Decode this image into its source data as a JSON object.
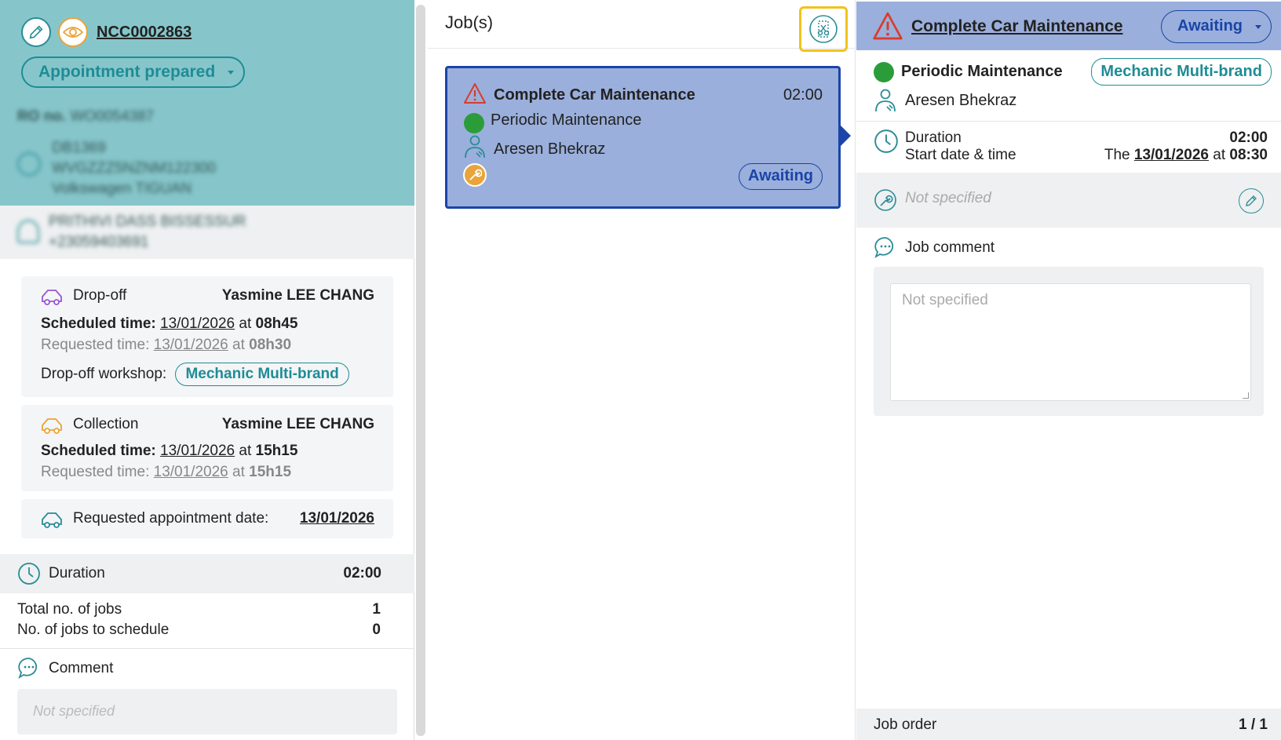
{
  "left": {
    "order_no": "NCC0002863",
    "status": "Appointment prepared",
    "ro_label": "RO no.",
    "ro_value": "WO0054387",
    "vehicle_code": "DB1369",
    "vin": "WVGZZZ5NZNM122300",
    "vehicle_model": "Volkswagen TIGUAN",
    "customer_name": "PRITHIVI DASS BISSESSUR",
    "customer_phone": "+23059403691",
    "dropoff": {
      "title": "Drop-off",
      "person": "Yasmine LEE CHANG",
      "scheduled_label": "Scheduled time:",
      "scheduled_date": "13/01/2026",
      "at": "at",
      "scheduled_time": "08h45",
      "requested_label": "Requested time:",
      "requested_date": "13/01/2026",
      "requested_time": "08h30",
      "workshop_label": "Drop-off workshop:",
      "workshop": "Mechanic Multi-brand"
    },
    "collection": {
      "title": "Collection",
      "person": "Yasmine LEE CHANG",
      "scheduled_label": "Scheduled time:",
      "scheduled_date": "13/01/2026",
      "at": "at",
      "scheduled_time": "15h15",
      "requested_label": "Requested time:",
      "requested_date": "13/01/2026",
      "requested_time": "15h15"
    },
    "requested_appt_label": "Requested appointment date:",
    "requested_appt_date": "13/01/2026",
    "duration_label": "Duration",
    "duration_value": "02:00",
    "total_jobs_label": "Total no. of jobs",
    "total_jobs_value": "1",
    "jobs_to_schedule_label": "No. of jobs to schedule",
    "jobs_to_schedule_value": "0",
    "comment_label": "Comment",
    "comment_placeholder": "Not specified"
  },
  "middle": {
    "title": "Job(s)",
    "job": {
      "name": "Complete Car Maintenance",
      "duration": "02:00",
      "type": "Periodic Maintenance",
      "technician": "Aresen Bhekraz",
      "status": "Awaiting"
    }
  },
  "right": {
    "job_name": "Complete Car Maintenance",
    "status": "Awaiting",
    "type": "Periodic Maintenance",
    "workshop": "Mechanic Multi-brand",
    "technician": "Aresen Bhekraz",
    "duration_label": "Duration",
    "duration_value": "02:00",
    "start_label": "Start date & time",
    "start_prefix": "The",
    "start_date": "13/01/2026",
    "start_at": "at",
    "start_time": "08:30",
    "tool_placeholder": "Not specified",
    "comment_label": "Job comment",
    "comment_placeholder": "Not specified",
    "job_order_label": "Job order",
    "job_order_value": "1 / 1"
  },
  "colors": {
    "teal_header": "#86c6cb",
    "teal_accent": "#1e8c95",
    "blue_card": "#9aafdb",
    "blue_accent": "#1a44a8",
    "warning_red": "#d93b2b",
    "status_green": "#2a9d3a",
    "tool_orange": "#e9a43a",
    "highlight_yellow": "#f2c21b"
  }
}
